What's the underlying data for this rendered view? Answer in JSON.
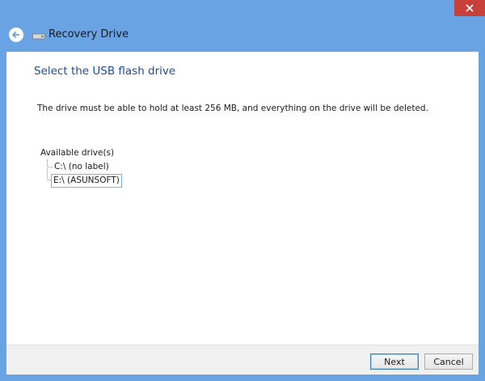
{
  "window": {
    "title": "Recovery Drive",
    "close_icon": "close-icon",
    "back_icon": "back-arrow-icon",
    "app_icon": "drive-icon"
  },
  "page": {
    "heading": "Select the USB flash drive",
    "description": "The drive must be able to hold at least 256 MB, and everything on the drive will be deleted."
  },
  "drives": {
    "label": "Available drive(s)",
    "items": [
      {
        "label": "C:\\ (no label)",
        "selected": false
      },
      {
        "label": "E:\\ (ASUNSOFT)",
        "selected": true
      }
    ]
  },
  "footer": {
    "next_label": "Next",
    "cancel_label": "Cancel"
  },
  "colors": {
    "frame": "#6aa3e3",
    "close": "#c7403a",
    "heading": "#1f4e99",
    "selection_border": "#7eb4ea"
  }
}
